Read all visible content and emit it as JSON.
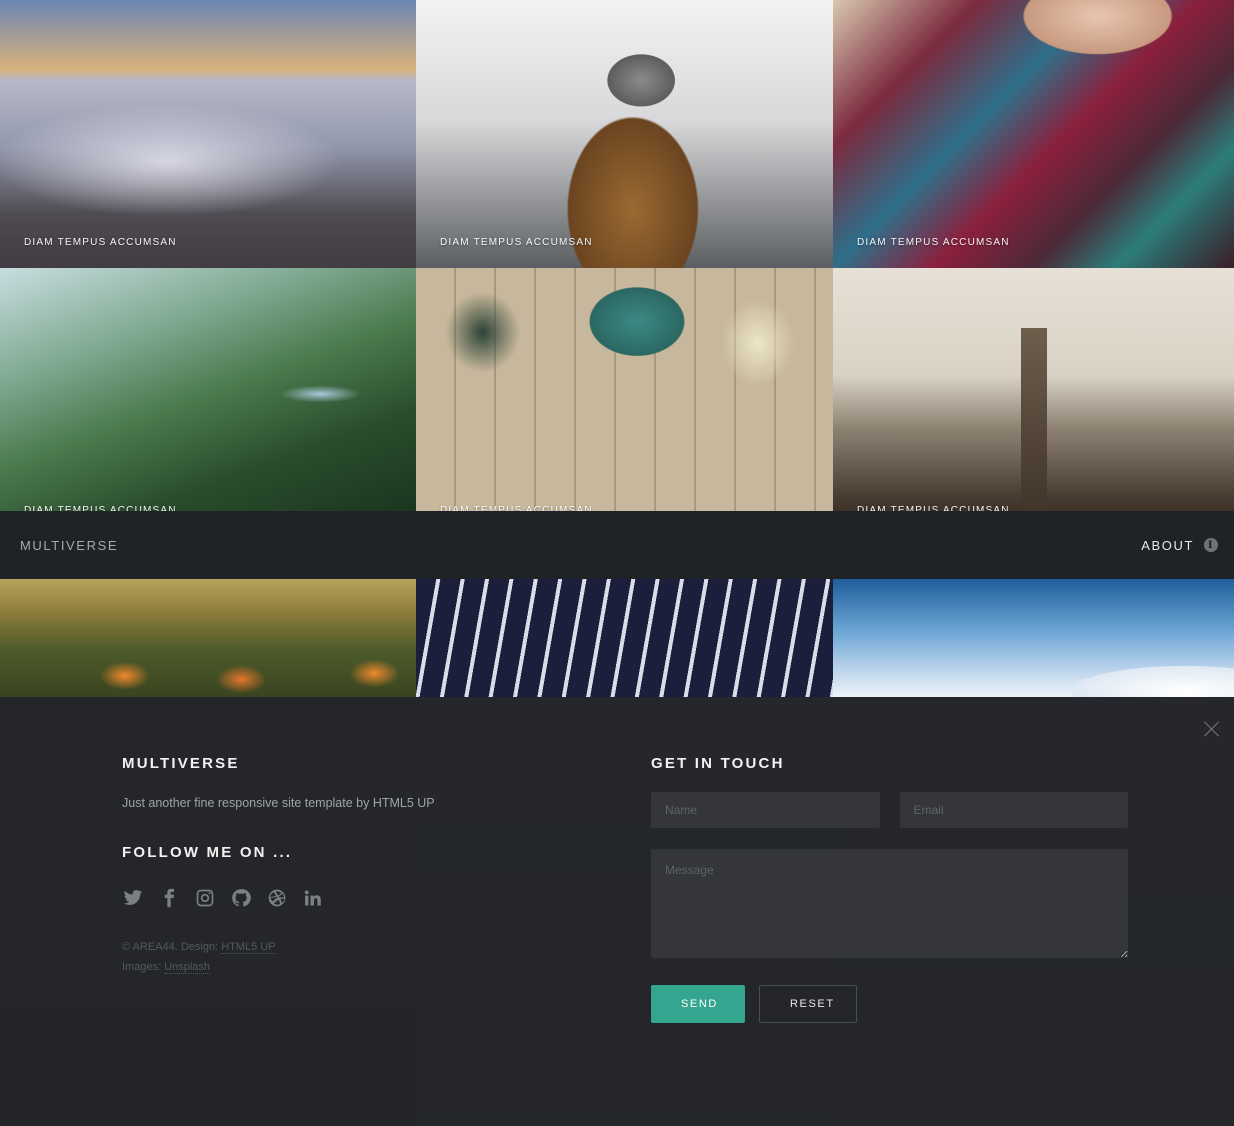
{
  "gallery": {
    "items": [
      {
        "caption": "DIAM TEMPUS ACCUMSAN"
      },
      {
        "caption": "DIAM TEMPUS ACCUMSAN"
      },
      {
        "caption": "DIAM TEMPUS ACCUMSAN"
      },
      {
        "caption": "DIAM TEMPUS ACCUMSAN"
      },
      {
        "caption": "DIAM TEMPUS ACCUMSAN"
      },
      {
        "caption": "DIAM TEMPUS ACCUMSAN"
      },
      {
        "caption": ""
      },
      {
        "caption": ""
      },
      {
        "caption": ""
      },
      {
        "caption": ""
      },
      {
        "caption": ""
      },
      {
        "caption": ""
      }
    ]
  },
  "header": {
    "brand": "MULTIVERSE",
    "about_label": "ABOUT",
    "info_icon": "i"
  },
  "panel": {
    "title": "MULTIVERSE",
    "blurb": "Just another fine responsive site template by HTML5 UP",
    "follow_title": "FOLLOW ME ON ...",
    "social": [
      "twitter-icon",
      "facebook-icon",
      "instagram-icon",
      "github-icon",
      "dribbble-icon",
      "linkedin-icon"
    ],
    "copyright_prefix": "© AREA44. Design: ",
    "copyright_link": "HTML5 UP",
    "images_prefix": "Images: ",
    "images_link": "Unsplash",
    "contact_title": "GET IN TOUCH",
    "name_placeholder": "Name",
    "email_placeholder": "Email",
    "message_placeholder": "Message",
    "send_label": "SEND",
    "reset_label": "RESET"
  },
  "colors": {
    "accent": "#34a58e",
    "header_bg": "#1f2226",
    "panel_bg": "#24262a"
  }
}
